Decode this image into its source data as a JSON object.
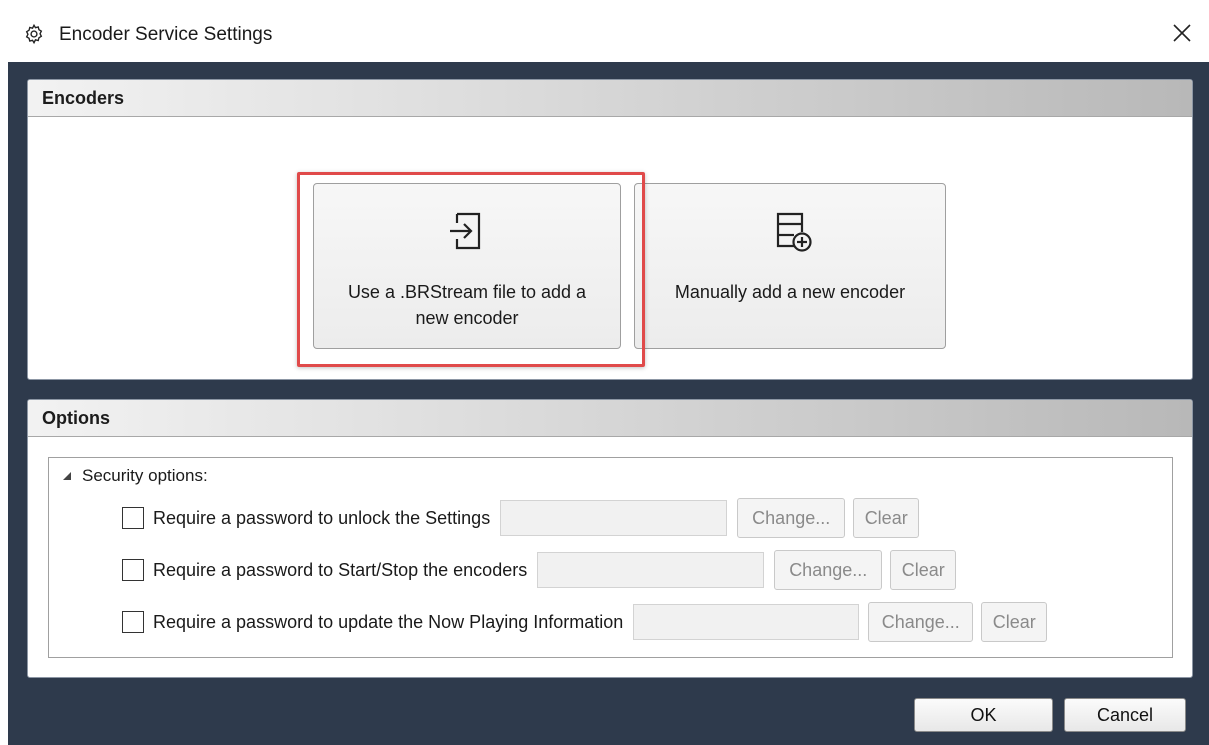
{
  "window": {
    "title": "Encoder Service Settings",
    "icon": "gear-icon",
    "close_glyph": "✕"
  },
  "encoders": {
    "header": "Encoders",
    "brstream_button": {
      "label": "Use a .BRStream file to add a new encoder",
      "icon": "import-icon",
      "highlighted": true,
      "highlight_color": "#e04a4a"
    },
    "manual_button": {
      "label": "Manually add a new encoder",
      "icon": "add-database-icon"
    }
  },
  "options": {
    "header": "Options",
    "security_label": "Security options:",
    "rows": [
      {
        "label": "Require a password to unlock the Settings",
        "checked": false,
        "password": "",
        "change_label": "Change...",
        "clear_label": "Clear"
      },
      {
        "label": "Require a password to Start/Stop the encoders",
        "checked": false,
        "password": "",
        "change_label": "Change...",
        "clear_label": "Clear"
      },
      {
        "label": "Require a password to update the Now Playing Information",
        "checked": false,
        "password": "",
        "change_label": "Change...",
        "clear_label": "Clear"
      }
    ]
  },
  "footer": {
    "ok_label": "OK",
    "cancel_label": "Cancel"
  },
  "colors": {
    "background": "#2e3a4c",
    "highlight": "#e04a4a"
  }
}
